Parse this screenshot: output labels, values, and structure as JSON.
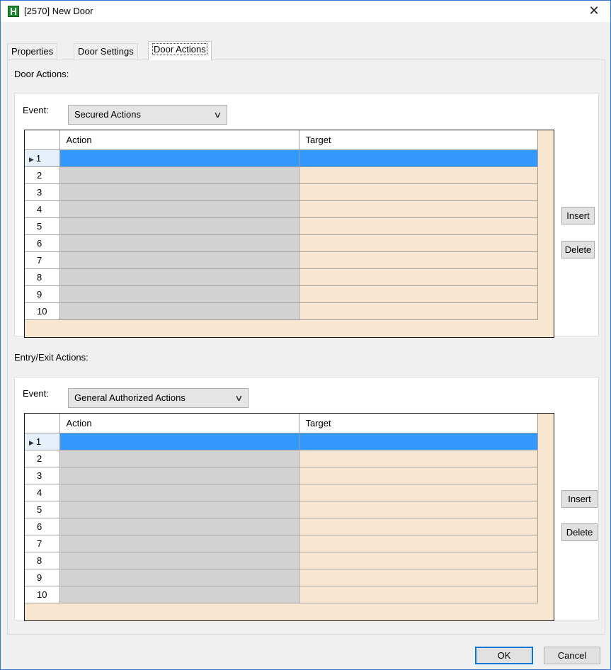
{
  "window": {
    "title": "[2570] New Door",
    "close_glyph": "✕"
  },
  "tabs": [
    {
      "label": "Properties",
      "selected": false
    },
    {
      "label": "Door Settings",
      "selected": false
    },
    {
      "label": "Door Actions",
      "selected": true
    }
  ],
  "door_actions": {
    "section_label": "Door Actions:",
    "event_label": "Event:",
    "event_value": "Secured Actions",
    "columns": [
      "Action",
      "Target"
    ],
    "rows": [
      "1",
      "2",
      "3",
      "4",
      "5",
      "6",
      "7",
      "8",
      "9",
      "10"
    ],
    "selected_row": 0,
    "insert_label": "Insert",
    "delete_label": "Delete"
  },
  "entry_exit_actions": {
    "section_label": "Entry/Exit Actions:",
    "event_label": "Event:",
    "event_value": "General Authorized Actions",
    "columns": [
      "Action",
      "Target"
    ],
    "rows": [
      "1",
      "2",
      "3",
      "4",
      "5",
      "6",
      "7",
      "8",
      "9",
      "10"
    ],
    "selected_row": 0,
    "insert_label": "Insert",
    "delete_label": "Delete"
  },
  "footer": {
    "ok_label": "OK",
    "cancel_label": "Cancel"
  },
  "icons": {
    "app": "door-app-icon",
    "close": "close-icon",
    "dropdown": "chevron-down-icon",
    "row_pointer": "row-pointer-icon"
  },
  "colors": {
    "selection": "#3399ff",
    "action_cell": "#d3d3d3",
    "target_cell": "#f9e6d1",
    "accent_border": "#0078d7"
  }
}
